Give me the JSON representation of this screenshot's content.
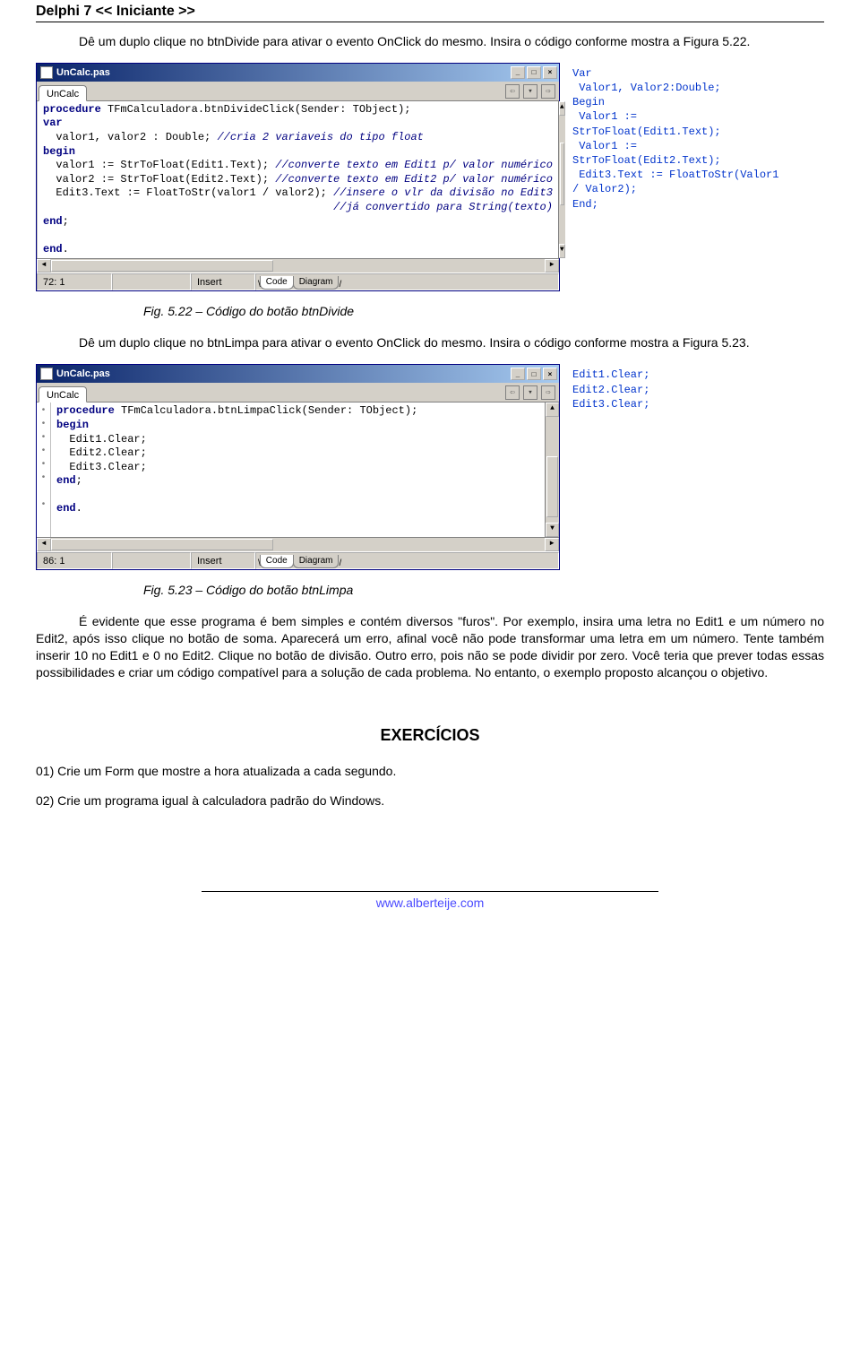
{
  "header": "Delphi 7   << Iniciante >>",
  "para1": "Dê um duplo clique no btnDivide para ativar o evento OnClick do mesmo. Insira o código conforme mostra a Figura 5.22.",
  "editor1": {
    "title": "UnCalc.pas",
    "tab": "UnCalc",
    "code_plain": "procedure TFmCalculadora.btnDivideClick(Sender: TObject);\nvar\n  valor1, valor2 : Double; //cria 2 variaveis do tipo float\nbegin\n  valor1 := StrToFloat(Edit1.Text); //converte texto em Edit1 p/ valor numérico\n  valor2 := StrToFloat(Edit2.Text); //converte texto em Edit2 p/ valor numérico\n  Edit3.Text := FloatToStr(valor1 / valor2); //insere o vlr da divisão no Edit3\n                                             //já convertido para String(texto)\nend;\n\nend.\n",
    "pos": "72: 1",
    "insert": "Insert",
    "status_mode": "",
    "bottom_tab1": "Code",
    "bottom_tab2": "Diagram"
  },
  "sidecode1": "Var\n Valor1, Valor2:Double;\nBegin\n Valor1 :=\nStrToFloat(Edit1.Text);\n Valor1 :=\nStrToFloat(Edit2.Text);\n Edit3.Text := FloatToStr(Valor1\n/ Valor2);\nEnd;",
  "figcap1": "Fig. 5.22 – Código do botão btnDivide",
  "para2": "Dê um duplo clique no btnLimpa para ativar o evento OnClick do mesmo. Insira o código conforme mostra a Figura 5.23.",
  "editor2": {
    "title": "UnCalc.pas",
    "tab": "UnCalc",
    "code_plain": "procedure TFmCalculadora.btnLimpaClick(Sender: TObject);\nbegin\n  Edit1.Clear;\n  Edit2.Clear;\n  Edit3.Clear;\nend;\n\nend.\n",
    "pos": "86: 1",
    "insert": "Insert",
    "status_mode": "",
    "bottom_tab1": "Code",
    "bottom_tab2": "Diagram"
  },
  "sidecode2": "Edit1.Clear;\nEdit2.Clear;\nEdit3.Clear;",
  "figcap2": "Fig. 5.23 – Código do botão btnLimpa",
  "para3": "É evidente que esse programa é bem simples e contém diversos \"furos\". Por exemplo, insira uma letra no Edit1 e um número no Edit2, após isso clique no botão de soma. Aparecerá um erro, afinal você não pode transformar uma letra em um número. Tente também inserir 10 no Edit1 e 0 no Edit2. Clique no botão de divisão. Outro erro, pois não se pode dividir por zero. Você teria que prever todas essas possibilidades e criar um código compatível para a solução de cada problema. No entanto, o exemplo proposto alcançou o objetivo.",
  "exercises_title": "EXERCÍCIOS",
  "ex1": "01) Crie um Form que mostre a hora atualizada a cada segundo.",
  "ex2": "02) Crie um programa igual à calculadora padrão do Windows.",
  "footer": "www.alberteije.com"
}
